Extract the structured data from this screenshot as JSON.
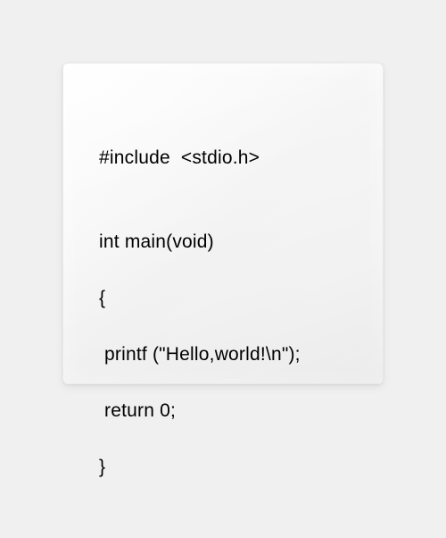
{
  "code": {
    "lines": [
      "#include  <stdio.h>",
      "",
      "int main(void)",
      "{",
      " printf (\"Hello,world!\\n\");",
      " return 0;",
      "}"
    ]
  }
}
